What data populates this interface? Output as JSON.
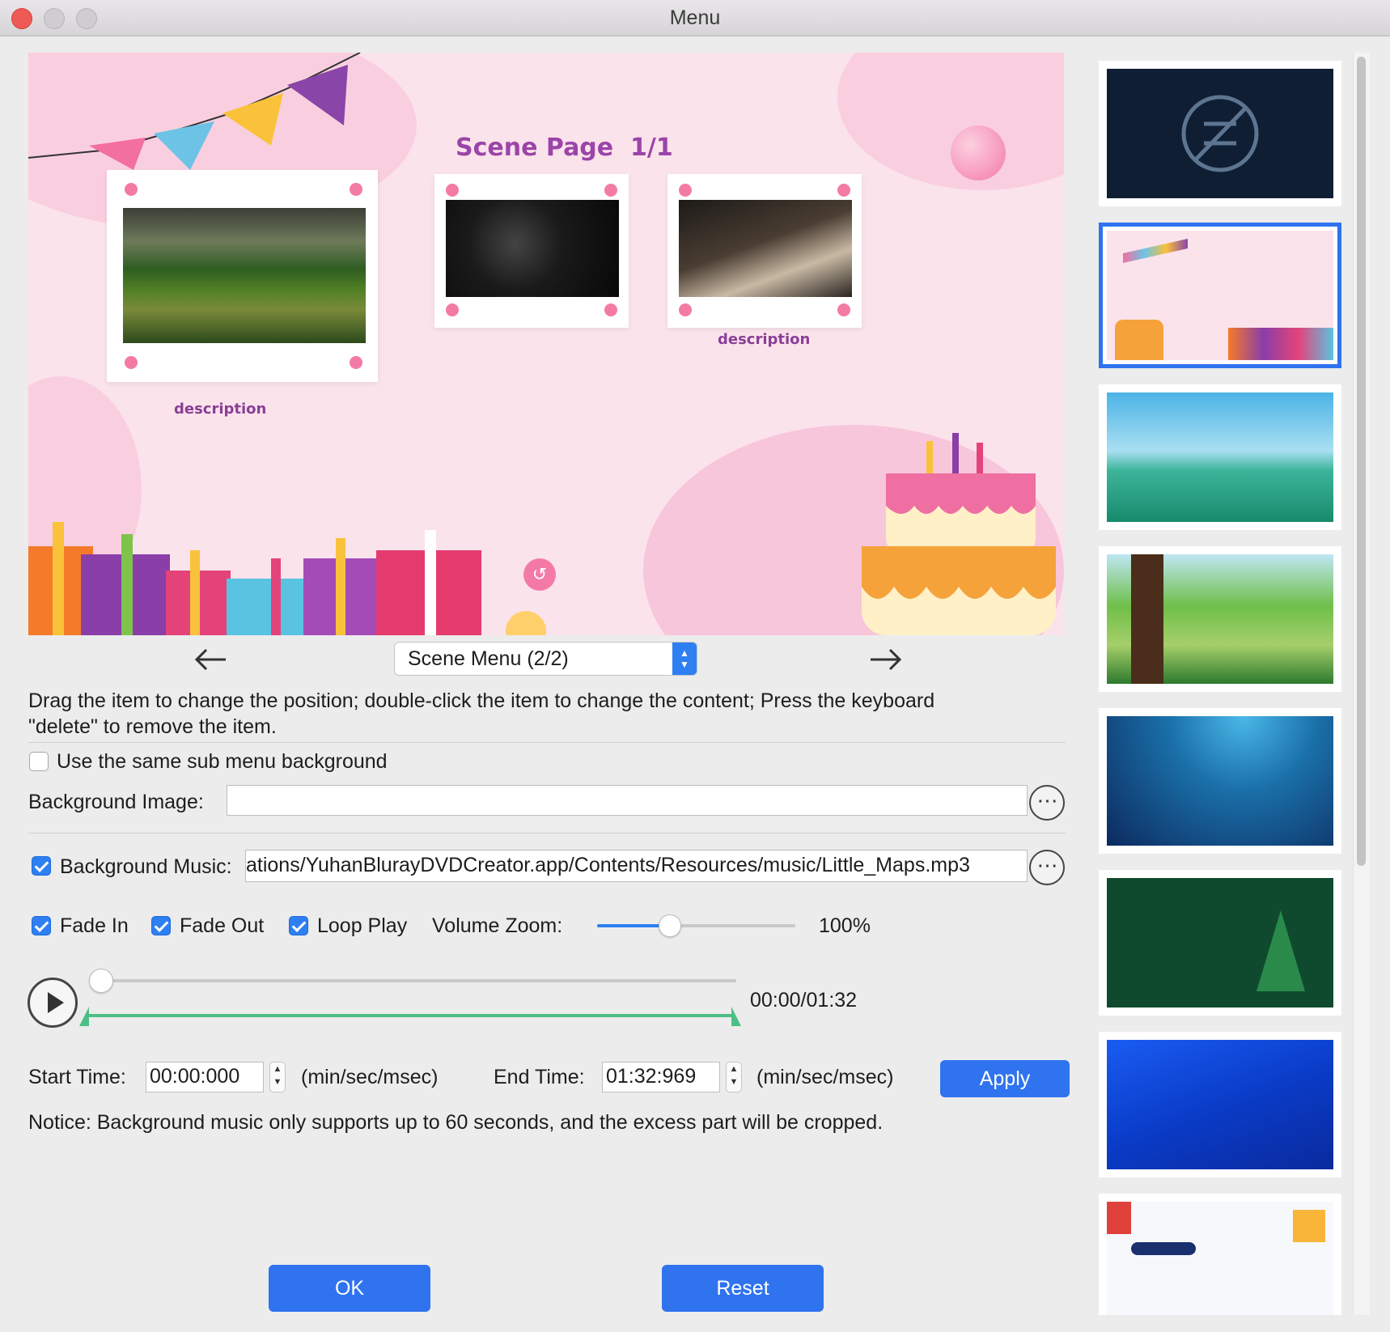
{
  "window": {
    "title": "Menu"
  },
  "preview": {
    "page_title": "Scene Page  1/1",
    "items": [
      {
        "description": "description"
      },
      {
        "description": ""
      },
      {
        "description": "description"
      }
    ]
  },
  "navigation": {
    "prev_icon": "left-arrow-icon",
    "next_icon": "right-arrow-icon",
    "menu_select_value": "Scene Menu (2/2)"
  },
  "instructions": {
    "line1": "Drag the item to change the position; double-click the item to change the content; Press the keyboard",
    "line2": "\"delete\" to remove the item."
  },
  "options": {
    "same_background_label": "Use the same sub menu background",
    "same_background_checked": false,
    "background_image_label": "Background Image:",
    "background_image_value": "",
    "background_music_label": "Background Music:",
    "background_music_checked": true,
    "background_music_value": "ations/YuhanBlurayDVDCreator.app/Contents/Resources/music/Little_Maps.mp3",
    "browse_label": "⋯",
    "fade_in_label": "Fade In",
    "fade_out_label": "Fade Out",
    "loop_play_label": "Loop Play",
    "volume_label": "Volume Zoom:",
    "volume_value": "100%",
    "volume_level": 0.35
  },
  "player": {
    "time_display": "00:00/01:32",
    "playback_progress": 0.0
  },
  "timing": {
    "start_label": "Start Time:",
    "start_value": "00:00:000",
    "start_unit": "(min/sec/msec)",
    "end_label": "End Time:",
    "end_value": "01:32:969",
    "end_unit": "(min/sec/msec)",
    "apply_label": "Apply"
  },
  "notice": "Notice: Background music only supports up to 60 seconds, and the excess part will be cropped.",
  "footer": {
    "ok_label": "OK",
    "reset_label": "Reset"
  },
  "templates": [
    {
      "name": "no-template",
      "selected": false
    },
    {
      "name": "birthday",
      "selected": true
    },
    {
      "name": "landscape",
      "selected": false
    },
    {
      "name": "forest",
      "selected": false
    },
    {
      "name": "underwater",
      "selected": false
    },
    {
      "name": "christmas",
      "selected": false
    },
    {
      "name": "blue-waves",
      "selected": false
    },
    {
      "name": "school",
      "selected": false
    }
  ],
  "colors": {
    "accent": "#2f73ef",
    "check": "#2d7ff2",
    "trim_bar": "#4cbf86",
    "title_purple": "#8a3f96"
  }
}
